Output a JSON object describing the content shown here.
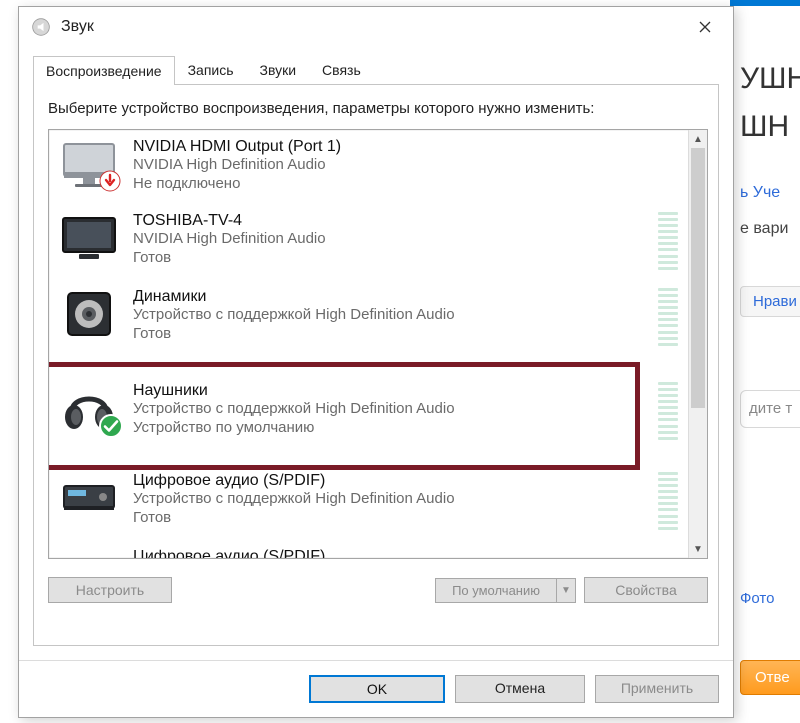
{
  "background": {
    "heading1": "УШН",
    "heading2": "ШН",
    "uchen": "ь Уче",
    "variant": "е вари",
    "like": "Нрави",
    "inputPh": "дите т",
    "photo": "Фото",
    "answer": "Отве"
  },
  "dialog": {
    "title": "Звук",
    "tabs": [
      "Воспроизведение",
      "Запись",
      "Звуки",
      "Связь"
    ],
    "instruction": "Выберите устройство воспроизведения, параметры которого нужно изменить:",
    "devices": [
      {
        "name": "NVIDIA HDMI Output (Port 1)",
        "sub1": "NVIDIA High Definition Audio",
        "sub2": "Не подключено",
        "icon": "monitor",
        "overlay": "down-red",
        "meter": false
      },
      {
        "name": "TOSHIBA-TV-4",
        "sub1": "NVIDIA High Definition Audio",
        "sub2": "Готов",
        "icon": "tv",
        "overlay": null,
        "meter": true
      },
      {
        "name": "Динамики",
        "sub1": "Устройство с поддержкой High Definition Audio",
        "sub2": "Готов",
        "icon": "speaker",
        "overlay": null,
        "meter": true
      },
      {
        "name": "Наушники",
        "sub1": "Устройство с поддержкой High Definition Audio",
        "sub2": "Устройство по умолчанию",
        "icon": "headphones",
        "overlay": "check-green",
        "meter": true
      },
      {
        "name": "Цифровое аудио (S/PDIF)",
        "sub1": "Устройство с поддержкой High Definition Audio",
        "sub2": "Готов",
        "icon": "receiver",
        "overlay": null,
        "meter": true
      },
      {
        "name": "Цифровое аудио (S/PDIF)",
        "sub1": "",
        "sub2": "",
        "icon": "receiver",
        "overlay": null,
        "meter": false
      }
    ],
    "buttons": {
      "configure": "Настроить",
      "setDefault": "По умолчанию",
      "properties": "Свойства",
      "ok": "OK",
      "cancel": "Отмена",
      "apply": "Применить"
    }
  }
}
